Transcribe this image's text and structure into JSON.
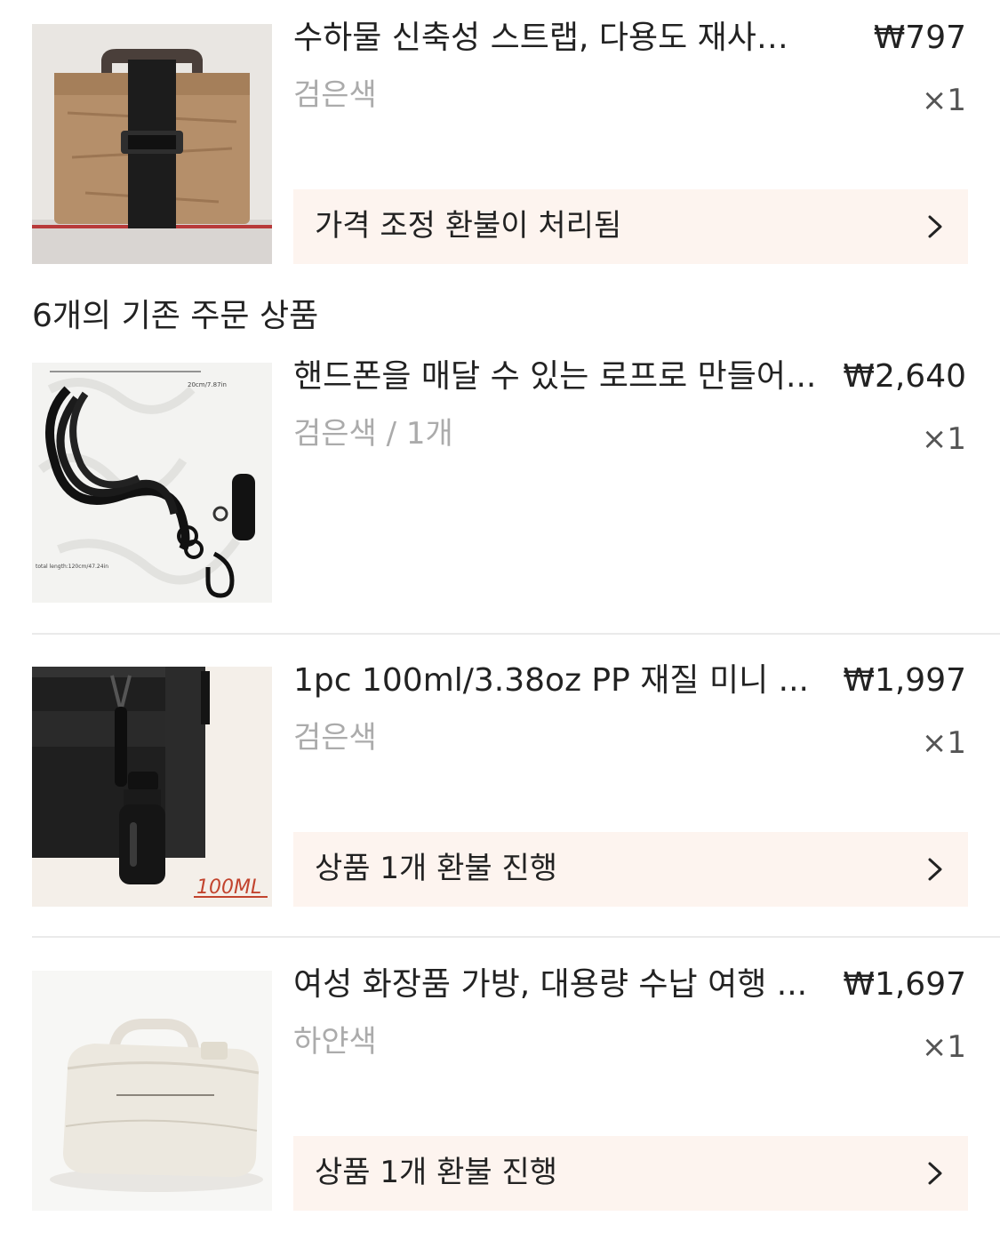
{
  "products": [
    {
      "title": "수하물 신축성 스트랩, 다용도 재사용 가...",
      "price": "₩797",
      "variant": "검은색",
      "qty": "×1",
      "action": "가격 조정 환불이 처리됨"
    },
    {
      "title": "핸드폰을 매달 수 있는 로프로 만들어...",
      "price": "₩2,640",
      "variant": "검은색 / 1개",
      "qty": "×1",
      "image_text_top": "20cm/7.87in",
      "image_text_bottom": "total length:120cm/47.24in"
    },
    {
      "title": "1pc 100ml/3.38oz PP 재질 미니 ...",
      "price": "₩1,997",
      "variant": "검은색",
      "qty": "×1",
      "action": "상품 1개 환불 진행",
      "image_text": "100ML"
    },
    {
      "title": "여성 화장품 가방, 대용량 수납 여행 ...",
      "price": "₩1,697",
      "variant": "하얀색",
      "qty": "×1",
      "action": "상품 1개 환불 진행"
    }
  ],
  "section_title": "6개의 기존 주문 상품",
  "colors": {
    "action_bg": "#fdf4ef",
    "muted_text": "#ababab",
    "divider": "#eaeaea"
  },
  "icons": {
    "chevron": "chevron-right-icon"
  }
}
